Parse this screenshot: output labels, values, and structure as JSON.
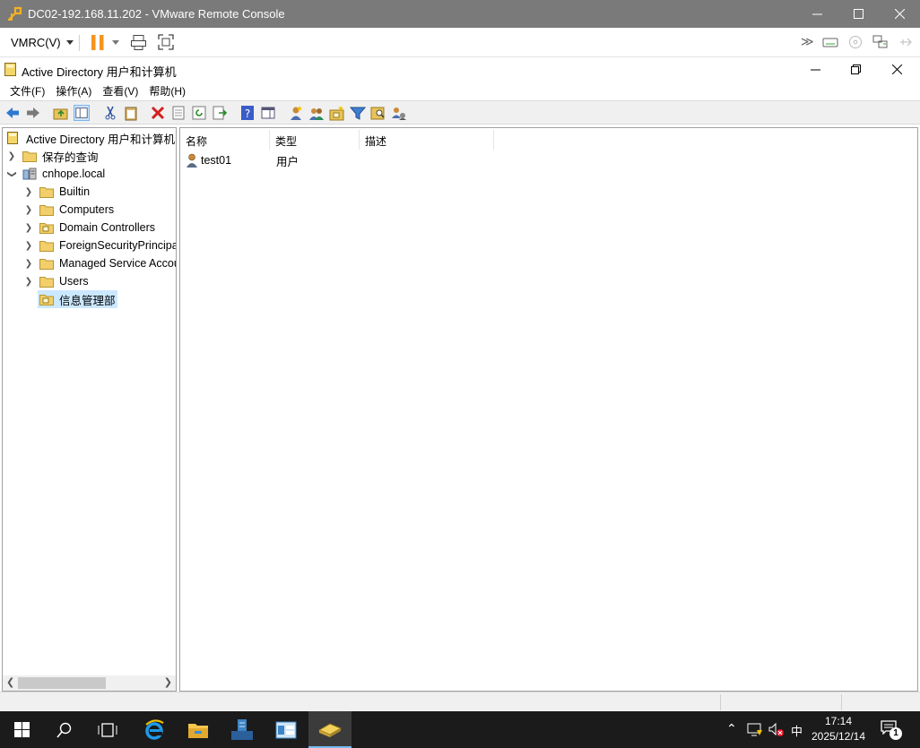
{
  "vmrc": {
    "title": "DC02-192.168.11.202 - VMware Remote Console",
    "menu_label": "VMRC(V)"
  },
  "mmc": {
    "title": "Active Directory 用户和计算机",
    "menu": [
      "文件(F)",
      "操作(A)",
      "查看(V)",
      "帮助(H)"
    ]
  },
  "tree": {
    "root": "Active Directory 用户和计算机",
    "saved_queries": "保存的查询",
    "domain": "cnhope.local",
    "children": [
      "Builtin",
      "Computers",
      "Domain Controllers",
      "ForeignSecurityPrincipals",
      "Managed Service Accounts",
      "Users",
      "信息管理部"
    ]
  },
  "list": {
    "columns": [
      "名称",
      "类型",
      "描述"
    ],
    "rows": [
      {
        "name": "test01",
        "type": "用户",
        "desc": ""
      }
    ]
  },
  "taskbar": {
    "time": "17:14",
    "date": "2025/12/14",
    "ime": "中",
    "notification_count": "1"
  },
  "colors": {
    "vm_title_bg": "#7a7a7a",
    "pause_orange": "#f7931e",
    "selection": "#cce8ff",
    "taskbar_bg": "#1b1b1b"
  }
}
